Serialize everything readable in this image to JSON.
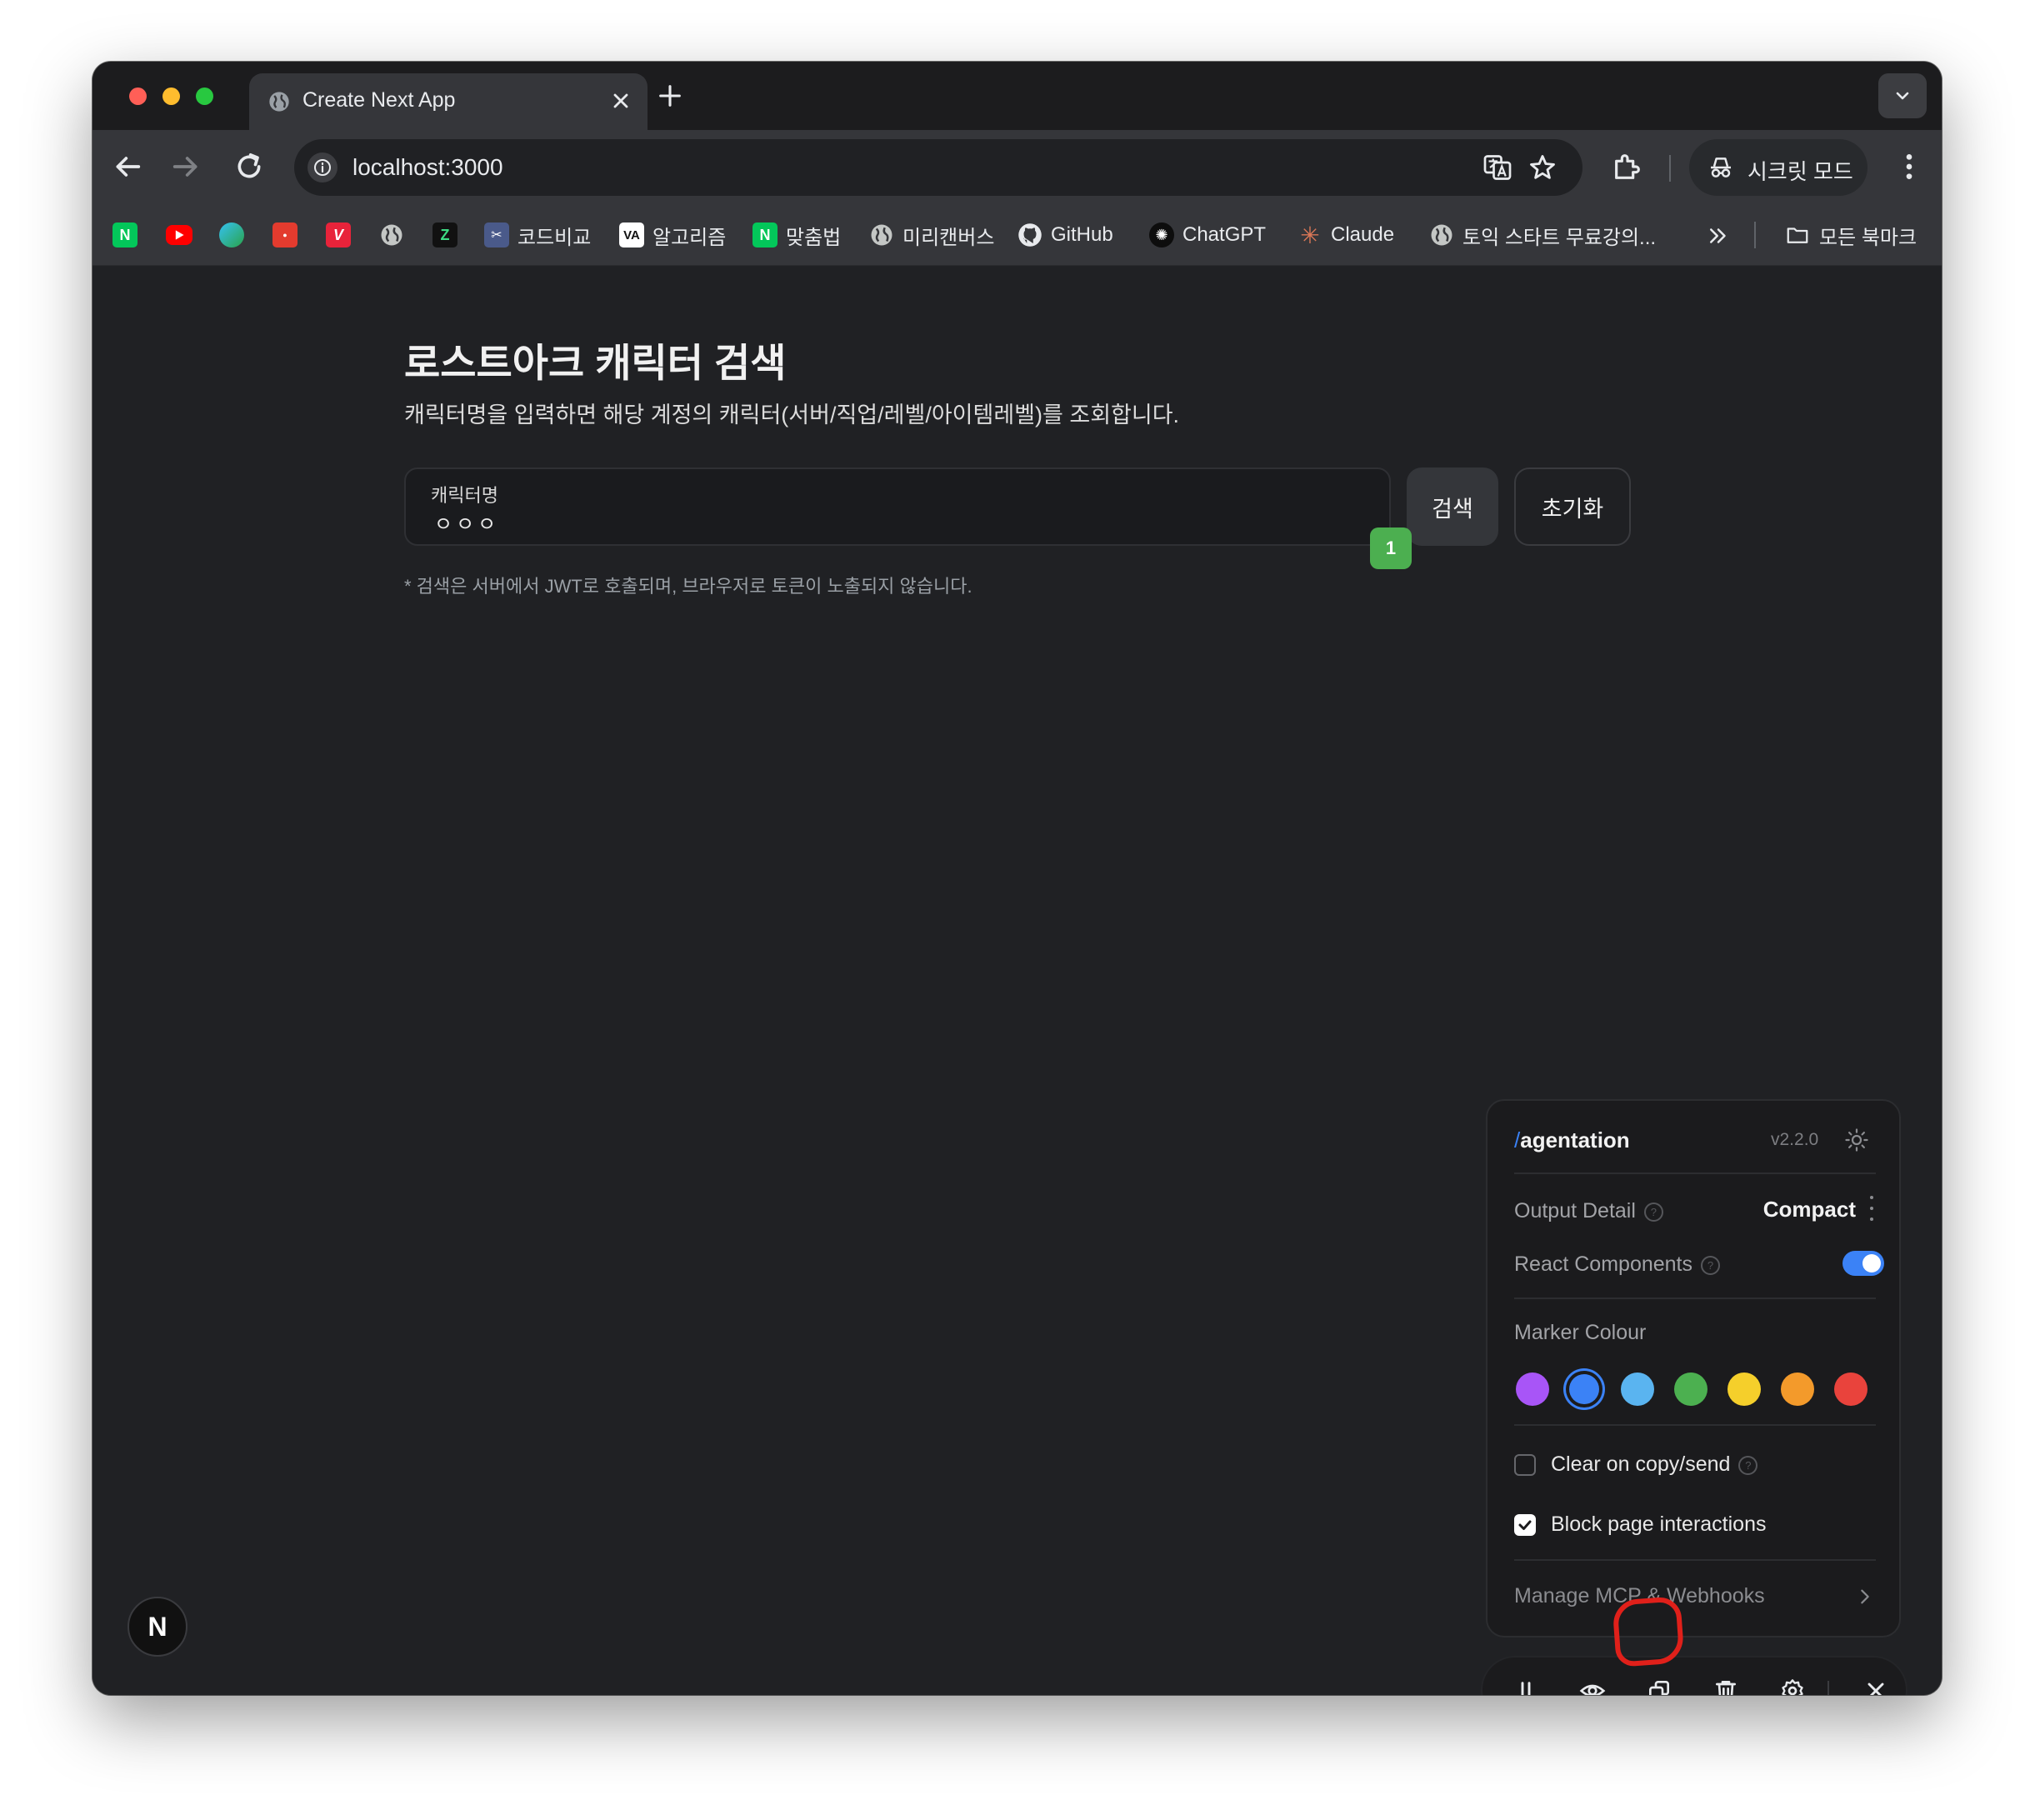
{
  "browser": {
    "tab_title": "Create Next App",
    "url": "localhost:3000",
    "incognito_label": "시크릿 모드",
    "bookmarks": [
      {
        "label": "",
        "icon": "naver-icon"
      },
      {
        "label": "",
        "icon": "youtube-icon"
      },
      {
        "label": "",
        "icon": "edge-icon"
      },
      {
        "label": "",
        "icon": "coupang-icon"
      },
      {
        "label": "",
        "icon": "v-icon"
      },
      {
        "label": "",
        "icon": "globe-icon"
      },
      {
        "label": "",
        "icon": "z-icon"
      },
      {
        "label": "코드비교",
        "icon": "compare-icon"
      },
      {
        "label": "알고리즘",
        "icon": "va-icon"
      },
      {
        "label": "맞춤법",
        "icon": "naver-icon"
      },
      {
        "label": "미리캔버스",
        "icon": "globe-icon"
      },
      {
        "label": "GitHub",
        "icon": "github-icon"
      },
      {
        "label": "ChatGPT",
        "icon": "chatgpt-icon"
      },
      {
        "label": "Claude",
        "icon": "claude-icon"
      },
      {
        "label": "토익 스타트 무료강의...",
        "icon": "globe-icon"
      }
    ],
    "all_bookmarks_label": "모든 북마크"
  },
  "page": {
    "title": "로스트아크 캐릭터 검색",
    "description": "캐릭터명을 입력하면 해당 계정의 캐릭터(서버/직업/레벨/아이템레벨)를 조회합니다.",
    "field_label": "캐릭터명",
    "field_value": "ㅇㅇㅇ",
    "search_button": "검색",
    "reset_button": "초기화",
    "marker_number": "1",
    "note": "* 검색은 서버에서 JWT로 호출되며, 브라우저로 토큰이 노출되지 않습니다.",
    "next_badge": "N"
  },
  "agentation": {
    "slash": "/",
    "name": "agentation",
    "version": "v2.2.0",
    "output_detail_label": "Output Detail",
    "output_detail_value": "Compact",
    "react_components_label": "React Components",
    "react_components_enabled": true,
    "marker_colour_label": "Marker Colour",
    "marker_colours": [
      "#a855f7",
      "#3b82f6",
      "#5ab4f0",
      "#4cb050",
      "#f5cf2b",
      "#f39a2b",
      "#e9433c"
    ],
    "selected_colour": "#3b82f6",
    "clear_on_copy_label": "Clear on copy/send",
    "clear_on_copy_checked": false,
    "block_interactions_label": "Block page interactions",
    "block_interactions_checked": true,
    "manage_label": "Manage MCP & Webhooks",
    "toolbar_icons": [
      "pause-icon",
      "eye-icon",
      "copy-icon",
      "trash-icon",
      "gear-icon",
      "close-icon"
    ]
  }
}
